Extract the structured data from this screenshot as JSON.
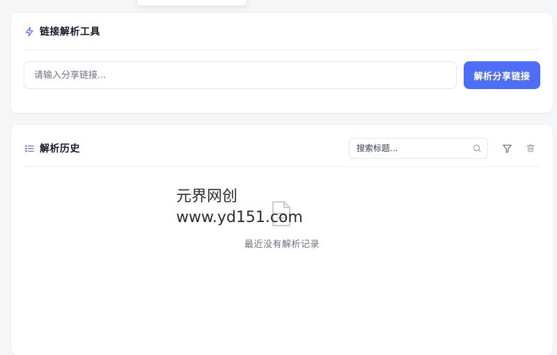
{
  "tool_card": {
    "title": "链接解析工具",
    "input_placeholder": "请输入分享链接...",
    "input_value": "",
    "parse_button_label": "解析分享链接"
  },
  "history_card": {
    "title": "解析历史",
    "search_placeholder": "搜索标题...",
    "empty_text": "最近没有解析记录"
  },
  "watermark": {
    "line1": "元界网创",
    "line2": "www.yd151.com"
  },
  "colors": {
    "accent": "#4f6ef7",
    "page_bg": "#f5f6f8",
    "card_bg": "#ffffff",
    "muted_icon": "#9ca3af"
  },
  "icons": {
    "tool_title": "lightning-icon",
    "history_title": "list-icon",
    "search": "search-icon",
    "filter": "filter-icon",
    "delete": "trash-icon",
    "empty": "file-icon"
  }
}
